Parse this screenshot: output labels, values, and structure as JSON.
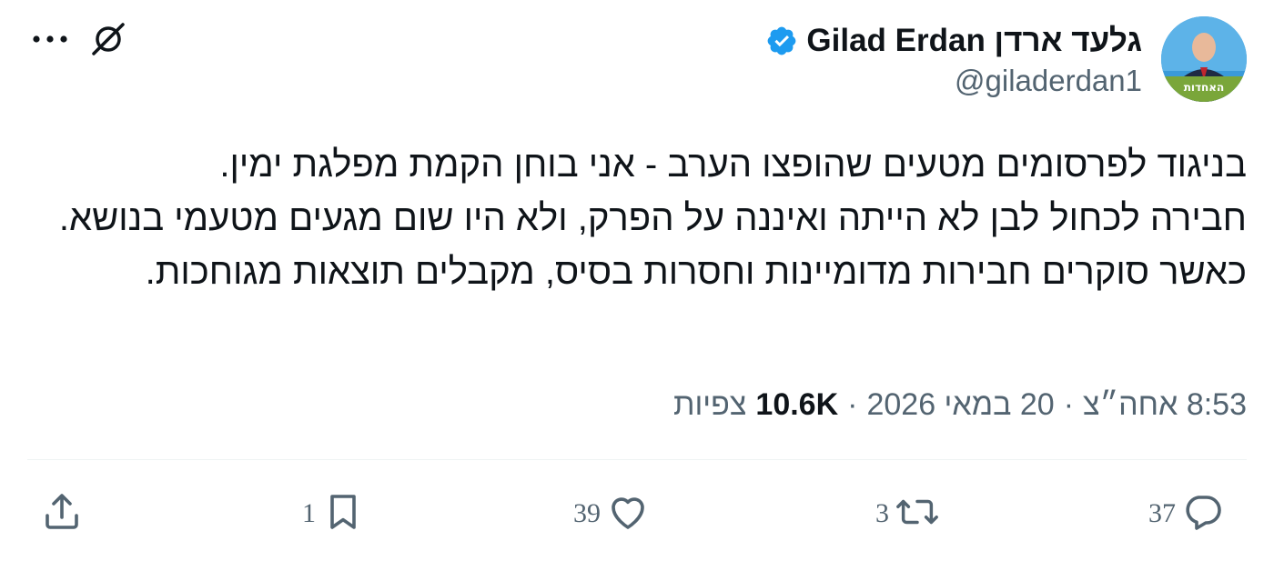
{
  "author": {
    "display_name": "Gilad Erdan גלעד ארדן",
    "handle": "@giladerdan1",
    "verified": true,
    "avatar_badge_text": "האחדות"
  },
  "tweet": {
    "lines": [
      "בניגוד לפרסומים מטעים שהופצו הערב - אני בוחן הקמת מפלגת ימין.",
      "חבירה לכחול לבן לא הייתה ואיננה על הפרק, ולא היו שום מגעים מטעמי בנושא.",
      "כאשר סוקרים חבירות מדומיינות וחסרות בסיס, מקבלים תוצאות מגוחכות."
    ]
  },
  "meta": {
    "time": "8:53 אחה״צ",
    "date": "20 במאי 2026",
    "views_count": "10.6K",
    "views_label": "צפיות",
    "separator": "·"
  },
  "actions": {
    "reply_count": "37",
    "retweet_count": "3",
    "like_count": "39",
    "bookmark_count": "1"
  },
  "icons": {
    "top_left": [
      "more-icon",
      "grok-icon"
    ],
    "actions": [
      "reply-icon",
      "retweet-icon",
      "like-icon",
      "bookmark-icon",
      "share-icon"
    ]
  },
  "colors": {
    "text_primary": "#0f1419",
    "text_secondary": "#536471",
    "verified": "#1d9bf0",
    "divider": "#eff3f4"
  }
}
